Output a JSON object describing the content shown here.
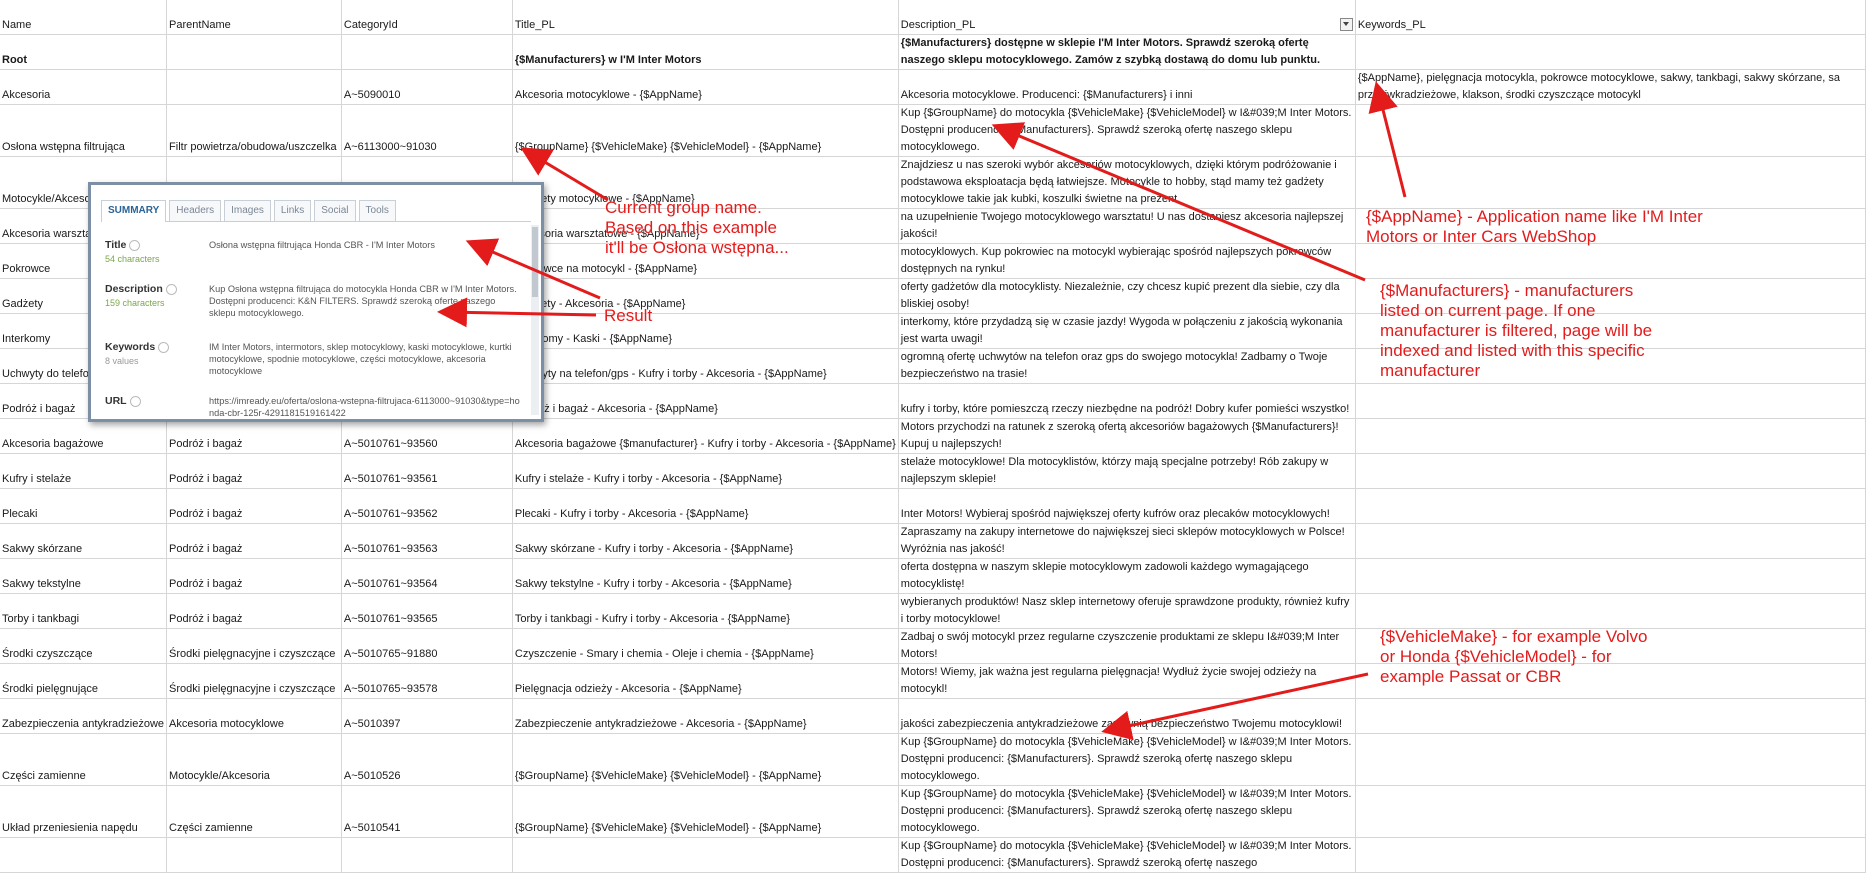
{
  "columns": [
    "Name",
    "ParentName",
    "CategoryId",
    "Title_PL",
    "Description_PL",
    "Keywords_PL"
  ],
  "rows": [
    {
      "name": "Root",
      "parent": "",
      "cat": "",
      "title": "{$Manufacturers} w I'M Inter Motors",
      "desc": "{$Manufacturers} dostępne w sklepie I'M Inter Motors. Sprawdź szeroką ofertę naszego sklepu motocyklowego. Zamów z szybką dostawą do domu lub punktu.",
      "kw": ""
    },
    {
      "name": "Akcesoria",
      "parent": "",
      "cat": "A~5090010",
      "title": "Akcesoria motocyklowe - {$AppName}",
      "desc": "Akcesoria motocyklowe. Producenci: {$Manufacturers} i inni",
      "kw": "{$AppName}, pielęgnacja motocykla, pokrowce motocyklowe, sakwy, tankbagi, sakwy skórzane, sa przeciwkradzieżowe, klakson, środki czyszczące motocykl"
    },
    {
      "name": "Osłona wstępna filtrująca",
      "parent": "Filtr powietrza/obudowa/uszczelka",
      "cat": "A~6113000~91030",
      "title": "{$GroupName} {$VehicleMake} {$VehicleModel} - {$AppName}",
      "desc": "Kup {$GroupName} do motocykla {$VehicleMake} {$VehicleModel} w I&#039;M Inter Motors. Dostępni producenci: {$Manufacturers}. Sprawdź szeroką ofertę naszego sklepu motocyklowego.",
      "kw": ""
    },
    {
      "name": "Motocykle/Akcesoria",
      "parent": "",
      "cat": "",
      "title": "Gadżety motocyklowe - {$AppName}",
      "desc": "Znajdziesz u nas szeroki wybór akcesoriów motocyklowych, dzięki którym podróżowanie i podstawowa eksploatacja będą łatwiejsze. Motocykle to hobby, stąd mamy też gadżety motocyklowe takie jak kubki, koszulki świetne na prezent.",
      "kw": ""
    },
    {
      "name": "Akcesoria warsztatowe",
      "parent": "",
      "cat": "",
      "title": "Akcesoria warsztatowe - {$AppName}",
      "desc": "na uzupełnienie Twojego motocyklowego warsztatu! U nas dostaniesz akcesoria najlepszej jakości!",
      "kw": ""
    },
    {
      "name": "Pokrowce",
      "parent": "",
      "cat": "",
      "title": "Pokrowce na motocykl - {$AppName}",
      "desc": "motocyklowych. Kup pokrowiec na motocykl wybierając spośród najlepszych pokrowców dostępnych na rynku!",
      "kw": ""
    },
    {
      "name": "Gadżety",
      "parent": "",
      "cat": "",
      "title": "Gadżety - Akcesoria - {$AppName}",
      "desc": "oferty gadżetów dla motocyklisty. Niezależnie, czy chcesz kupić prezent dla siebie, czy dla bliskiej osoby!",
      "kw": ""
    },
    {
      "name": "Interkomy",
      "parent": "",
      "cat": "",
      "title": "Interkomy - Kaski - {$AppName}",
      "desc": "interkomy, które przydadzą się w czasie jazdy! Wygoda w połączeniu z jakością wykonania jest warta uwagi!",
      "kw": ""
    },
    {
      "name": "Uchwyty do telefonu/gps",
      "parent": "",
      "cat": "",
      "title": "Uchwyty na telefon/gps - Kufry i torby - Akcesoria - {$AppName}",
      "desc": "ogromną ofertę uchwytów na telefon oraz gps do swojego motocykla! Zadbamy o Twoje bezpieczeństwo na trasie!",
      "kw": ""
    },
    {
      "name": "Podróż i bagaż",
      "parent": "",
      "cat": "",
      "title": "Podróż i bagaż - Akcesoria - {$AppName}",
      "desc": "kufry i torby, które pomieszczą rzeczy niezbędne na podróż! Dobry kufer pomieści wszystko!",
      "kw": ""
    },
    {
      "name": "Akcesoria bagażowe",
      "parent": "Podróż i bagaż",
      "cat": "A~5010761~93560",
      "title": "Akcesoria bagażowe {$manufacturer} - Kufry i torby - Akcesoria - {$AppName}",
      "desc": "Motors przychodzi na ratunek z szeroką ofertą akcesoriów bagażowych {$Manufacturers}! Kupuj u najlepszych!",
      "kw": ""
    },
    {
      "name": "Kufry i stelaże",
      "parent": "Podróż i bagaż",
      "cat": "A~5010761~93561",
      "title": "Kufry i stelaże - Kufry i torby - Akcesoria - {$AppName}",
      "desc": "stelaże motocyklowe! Dla motocyklistów, którzy mają specjalne potrzeby! Rób zakupy w najlepszym sklepie!",
      "kw": ""
    },
    {
      "name": "Plecaki",
      "parent": "Podróż i bagaż",
      "cat": "A~5010761~93562",
      "title": "Plecaki - Kufry i torby - Akcesoria - {$AppName}",
      "desc": "Inter Motors! Wybieraj spośród największej oferty kufrów oraz plecaków motocyklowych!",
      "kw": ""
    },
    {
      "name": "Sakwy skórzane",
      "parent": "Podróż i bagaż",
      "cat": "A~5010761~93563",
      "title": "Sakwy skórzane - Kufry i torby - Akcesoria - {$AppName}",
      "desc": "Zapraszamy na zakupy internetowe do największej sieci sklepów motocyklowych w Polsce! Wyróżnia nas jakość!",
      "kw": ""
    },
    {
      "name": "Sakwy tekstylne",
      "parent": "Podróż i bagaż",
      "cat": "A~5010761~93564",
      "title": "Sakwy tekstylne - Kufry i torby - Akcesoria - {$AppName}",
      "desc": "oferta dostępna w naszym sklepie motocyklowym zadowoli każdego wymagającego motocyklistę!",
      "kw": ""
    },
    {
      "name": "Torby i tankbagi",
      "parent": "Podróż i bagaż",
      "cat": "A~5010761~93565",
      "title": "Torby i tankbagi - Kufry i torby - Akcesoria - {$AppName}",
      "desc": "wybieranych produktów! Nasz sklep internetowy oferuje sprawdzone produkty, również kufry i torby motocyklowe!",
      "kw": ""
    },
    {
      "name": "Środki czyszczące",
      "parent": "Środki pielęgnacyjne i czyszczące",
      "cat": "A~5010765~91880",
      "title": "Czyszczenie - Smary i chemia - Oleje i chemia - {$AppName}",
      "desc": "Zadbaj o swój motocykl przez regularne czyszczenie produktami ze sklepu I&#039;M Inter Motors!",
      "kw": ""
    },
    {
      "name": "Środki pielęgnujące",
      "parent": "Środki pielęgnacyjne i czyszczące",
      "cat": "A~5010765~93578",
      "title": "Pielęgnacja odzieży - Akcesoria - {$AppName}",
      "desc": "Motors! Wiemy, jak ważna jest regularna pielęgnacja! Wydłuż życie swojej odzieży na motocykl!",
      "kw": ""
    },
    {
      "name": "Zabezpieczenia antykradzieżowe",
      "parent": "Akcesoria motocyklowe",
      "cat": "A~5010397",
      "title": "Zabezpieczenie antykradzieżowe - Akcesoria - {$AppName}",
      "desc": "jakości zabezpieczenia antykradzieżowe zapewnią bezpieczeństwo Twojemu motocyklowi!",
      "kw": ""
    },
    {
      "name": "Części zamienne",
      "parent": "Motocykle/Akcesoria",
      "cat": "A~5010526",
      "title": "{$GroupName} {$VehicleMake} {$VehicleModel} - {$AppName}",
      "desc": "Kup {$GroupName} do motocykla {$VehicleMake} {$VehicleModel} w I&#039;M Inter Motors. Dostępni producenci: {$Manufacturers}. Sprawdź szeroką ofertę naszego sklepu motocyklowego.",
      "kw": ""
    },
    {
      "name": "Układ przeniesienia napędu",
      "parent": "Części zamienne",
      "cat": "A~5010541",
      "title": "{$GroupName} {$VehicleMake} {$VehicleModel} - {$AppName}",
      "desc": "Kup {$GroupName} do motocykla {$VehicleMake} {$VehicleModel} w I&#039;M Inter Motors. Dostępni producenci: {$Manufacturers}. Sprawdź szeroką ofertę naszego sklepu motocyklowego.",
      "kw": ""
    },
    {
      "name": "",
      "parent": "",
      "cat": "",
      "title": "",
      "desc": "Kup {$GroupName} do motocykla {$VehicleMake} {$VehicleModel} w I&#039;M Inter Motors. Dostępni producenci: {$Manufacturers}. Sprawdź szeroką ofertę naszego",
      "kw": ""
    }
  ],
  "popup": {
    "tabs": [
      "SUMMARY",
      "Headers",
      "Images",
      "Links",
      "Social",
      "Tools"
    ],
    "title_label": "Title",
    "title_count": "54 characters",
    "title_value": "Osłona wstępna filtrująca Honda CBR - I'M Inter Motors",
    "desc_label": "Description",
    "desc_count": "159 characters",
    "desc_value": "Kup Osłona wstępna filtrująca do motocykla Honda CBR w I'M Inter Motors. Dostępni producenci: K&N FILTERS. Sprawdź szeroką ofertę naszego sklepu motocyklowego.",
    "kw_label": "Keywords",
    "kw_count": "8 values",
    "kw_value": "IM Inter Motors, intermotors, sklep motocyklowy, kaski motocyklowe, kurtki motocyklowe, spodnie motocyklowe, części motocyklowe, akcesoria motocyklowe",
    "url_label": "URL",
    "url_value": "https://imready.eu/oferta/oslona-wstepna-filtrujaca-6113000~91030&type=honda-cbr-125r-4291181519161422"
  },
  "annotations": {
    "group": "Current group name. Based on this example it'll be Osłona wstępna...",
    "result": "Result",
    "appname": "{$AppName} - Application name like I'M Inter Motors or Inter Cars WebShop",
    "manufacturers": "{$Manufacturers} - manufacturers listed on current page. If one manufacturer is filtered, page will be indexed and listed with this specific manufacturer",
    "vehicle": "{$VehicleMake} - for example Volvo or Honda {$VehicleModel} - for example Passat or CBR"
  },
  "colors": {
    "annotation": "#e31b1b",
    "grid": "#d6d6d6",
    "popup_border": "#7c8fa4",
    "tab_active": "#2a6496",
    "count_green": "#7aa84a"
  }
}
